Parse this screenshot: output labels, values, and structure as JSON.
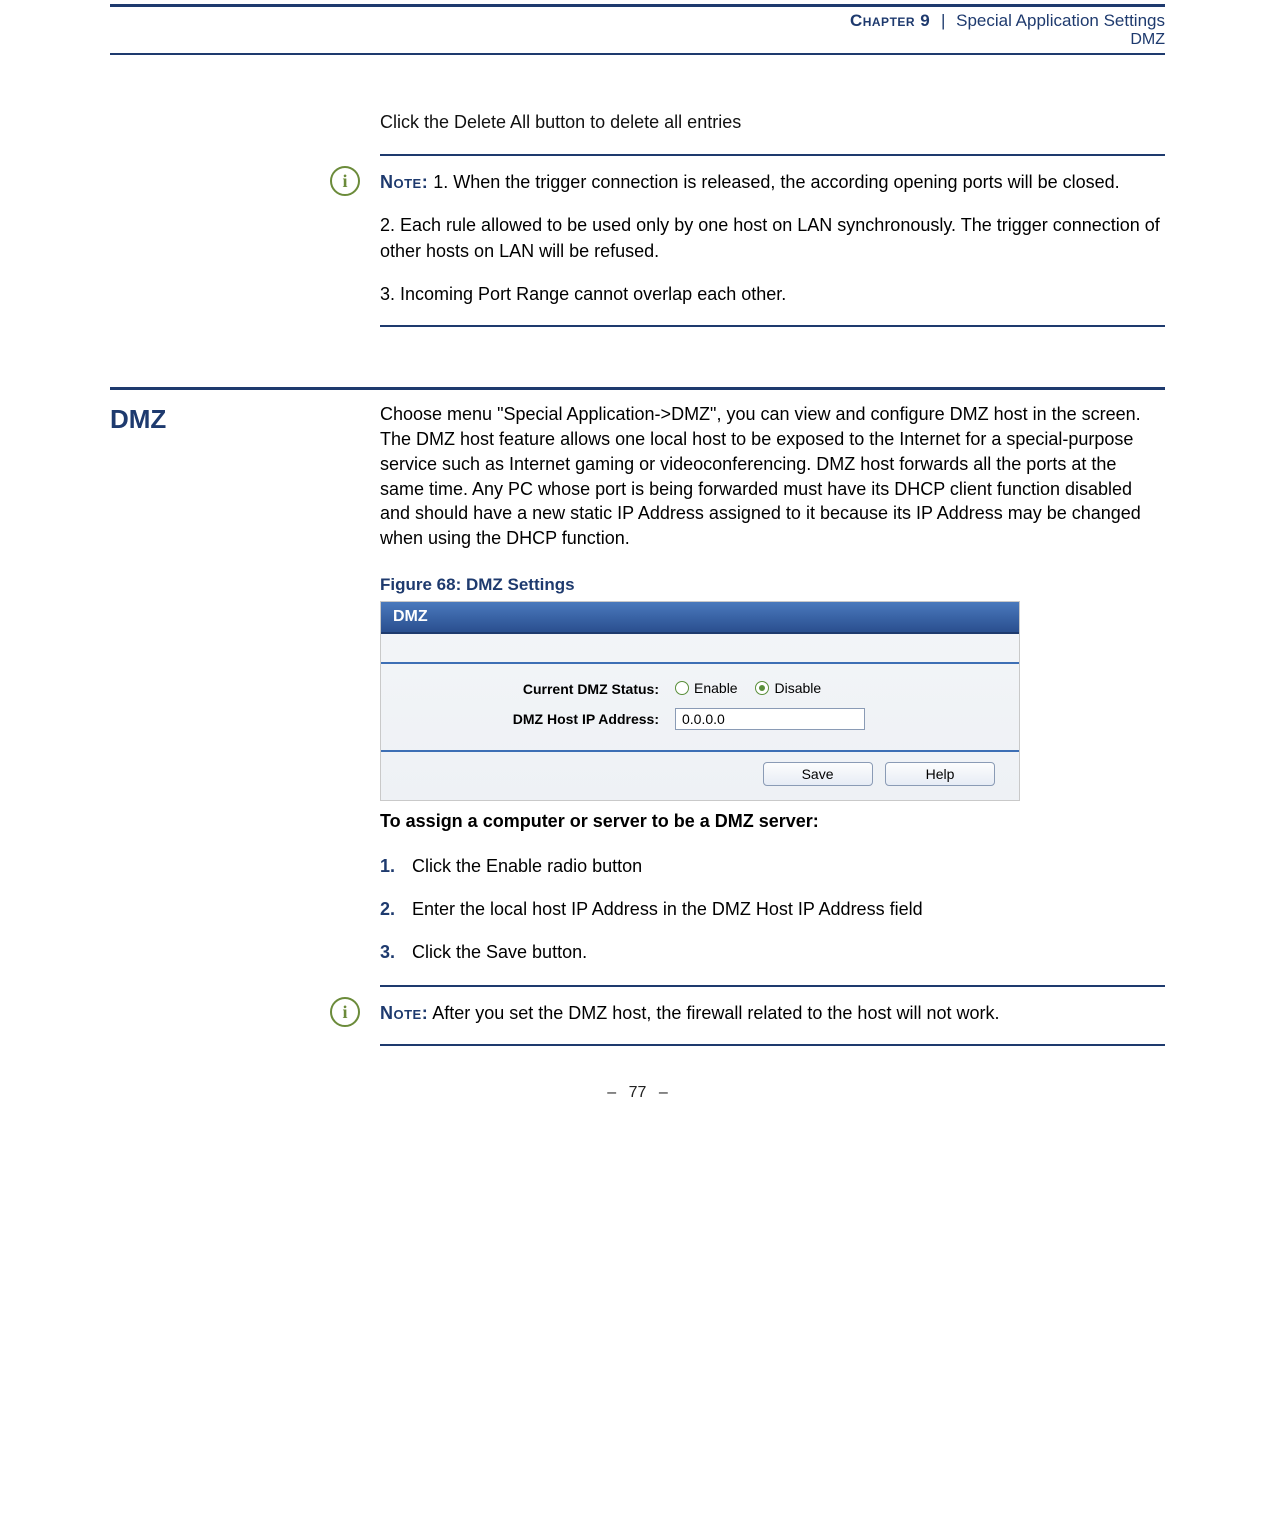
{
  "header": {
    "chapter_label": "Chapter 9",
    "separator": "|",
    "chapter_title": "Special Application Settings",
    "subhead": "DMZ"
  },
  "intro_para": "Click the Delete All button to delete all entries",
  "note1": {
    "label": "Note:",
    "p1": "1. When the trigger connection is released, the according opening ports will be closed.",
    "p2": "2. Each rule allowed to be used only by one host on LAN synchronously. The trigger connection of other hosts on LAN will be refused.",
    "p3": "3. Incoming Port Range cannot overlap each other."
  },
  "section": {
    "heading": "DMZ",
    "para": "Choose menu \"Special Application->DMZ\", you can view and configure DMZ host in the screen. The DMZ host feature allows one local host to be exposed to the Internet for a special-purpose service such as Internet gaming or videoconferencing. DMZ host forwards all the ports at the same time. Any PC whose port is being forwarded must have its DHCP client function disabled and should have a new static IP Address assigned to it because its IP Address may be changed when using the DHCP function.",
    "figure_caption": "Figure 68:  DMZ Settings"
  },
  "shot": {
    "title": "DMZ",
    "status_label": "Current DMZ Status:",
    "enable_label": "Enable",
    "disable_label": "Disable",
    "ip_label": "DMZ Host IP Address:",
    "ip_value": "0.0.0.0",
    "save_btn": "Save",
    "help_btn": "Help"
  },
  "assign_heading": "To assign a computer or server to be a DMZ server:",
  "steps": [
    {
      "num": "1.",
      "text": "Click the Enable radio button"
    },
    {
      "num": "2.",
      "text": "Enter the local host IP Address in the DMZ Host IP Address field"
    },
    {
      "num": "3.",
      "text": "Click the Save button."
    }
  ],
  "note2": {
    "label": "Note:",
    "text": "After you set the DMZ host, the firewall related to the host will not work."
  },
  "footer": {
    "dash": "–",
    "page": "77"
  }
}
